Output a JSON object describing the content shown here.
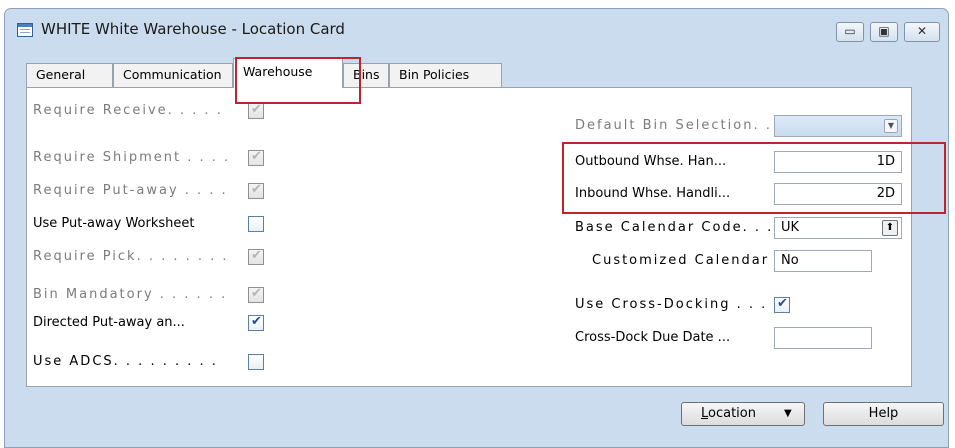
{
  "window": {
    "title": "WHITE White Warehouse - Location Card",
    "controls": {
      "minimize": "▭",
      "maximize": "▣",
      "close": "✕"
    }
  },
  "tabs": [
    {
      "label": "General"
    },
    {
      "label": "Communication"
    },
    {
      "label": "Warehouse",
      "active": true
    },
    {
      "label": "Bins"
    },
    {
      "label": "Bin Policies"
    }
  ],
  "left_fields": [
    {
      "label": "Require Receive. . . . .",
      "checked": true,
      "enabled": false
    },
    {
      "label": "Require Shipment . . . .",
      "checked": true,
      "enabled": false
    },
    {
      "label": "Require Put-away . . . .",
      "checked": true,
      "enabled": false
    },
    {
      "label": "Use Put-away Worksheet",
      "checked": false,
      "enabled": true
    },
    {
      "label": "Require Pick. . . . . . . .",
      "checked": true,
      "enabled": false
    },
    {
      "label": "Bin Mandatory . . . . . .",
      "checked": true,
      "enabled": false
    },
    {
      "label": "Directed Put-away an...",
      "checked": true,
      "enabled": true
    },
    {
      "label": "Use ADCS. . . . . . . . .",
      "checked": false,
      "enabled": true
    }
  ],
  "right_fields": {
    "default_bin_selection": {
      "label": "Default Bin Selection. . .",
      "value": ""
    },
    "outbound_handling": {
      "label": "Outbound Whse. Han...",
      "value": "1D"
    },
    "inbound_handling": {
      "label": "Inbound Whse. Handli...",
      "value": "2D"
    },
    "base_calendar": {
      "label": "Base Calendar Code. . .",
      "value": "UK"
    },
    "customized_calendar": {
      "label": "Customized Calendar .",
      "value": "No"
    },
    "use_cross_docking": {
      "label": "Use Cross-Docking . . .",
      "checked": true
    },
    "cross_dock_due_date": {
      "label": "Cross-Dock Due Date ...",
      "value": ""
    }
  },
  "buttons": {
    "location": {
      "label": "Location",
      "accel": "L",
      "rest": "ocation"
    },
    "help": {
      "label": "Help"
    }
  },
  "highlight_color": "#c0222f"
}
